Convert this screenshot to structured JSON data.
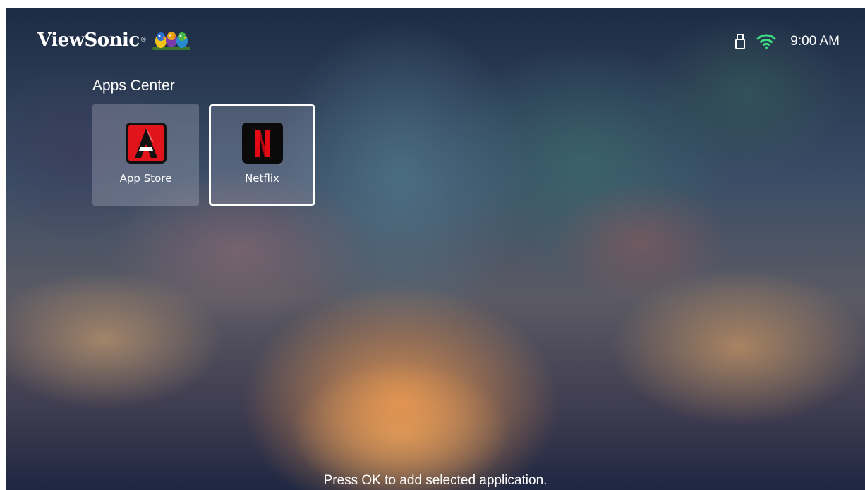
{
  "brand": {
    "name": "ViewSonic",
    "registered_mark": "®",
    "logo_icon": "three-birds-logo"
  },
  "status_bar": {
    "usb_icon": "usb-icon",
    "wifi_icon": "wifi-icon",
    "wifi_color": "#3ddc84",
    "time": "9:00 AM"
  },
  "apps_center": {
    "title": "Apps Center",
    "apps": [
      {
        "label": "App Store",
        "icon": "app-store-icon",
        "icon_color": "#e1131b",
        "selected": false
      },
      {
        "label": "Netflix",
        "icon": "netflix-icon",
        "icon_color": "#e50914",
        "selected": true
      }
    ]
  },
  "footer": {
    "hint": "Press OK to add selected application."
  }
}
